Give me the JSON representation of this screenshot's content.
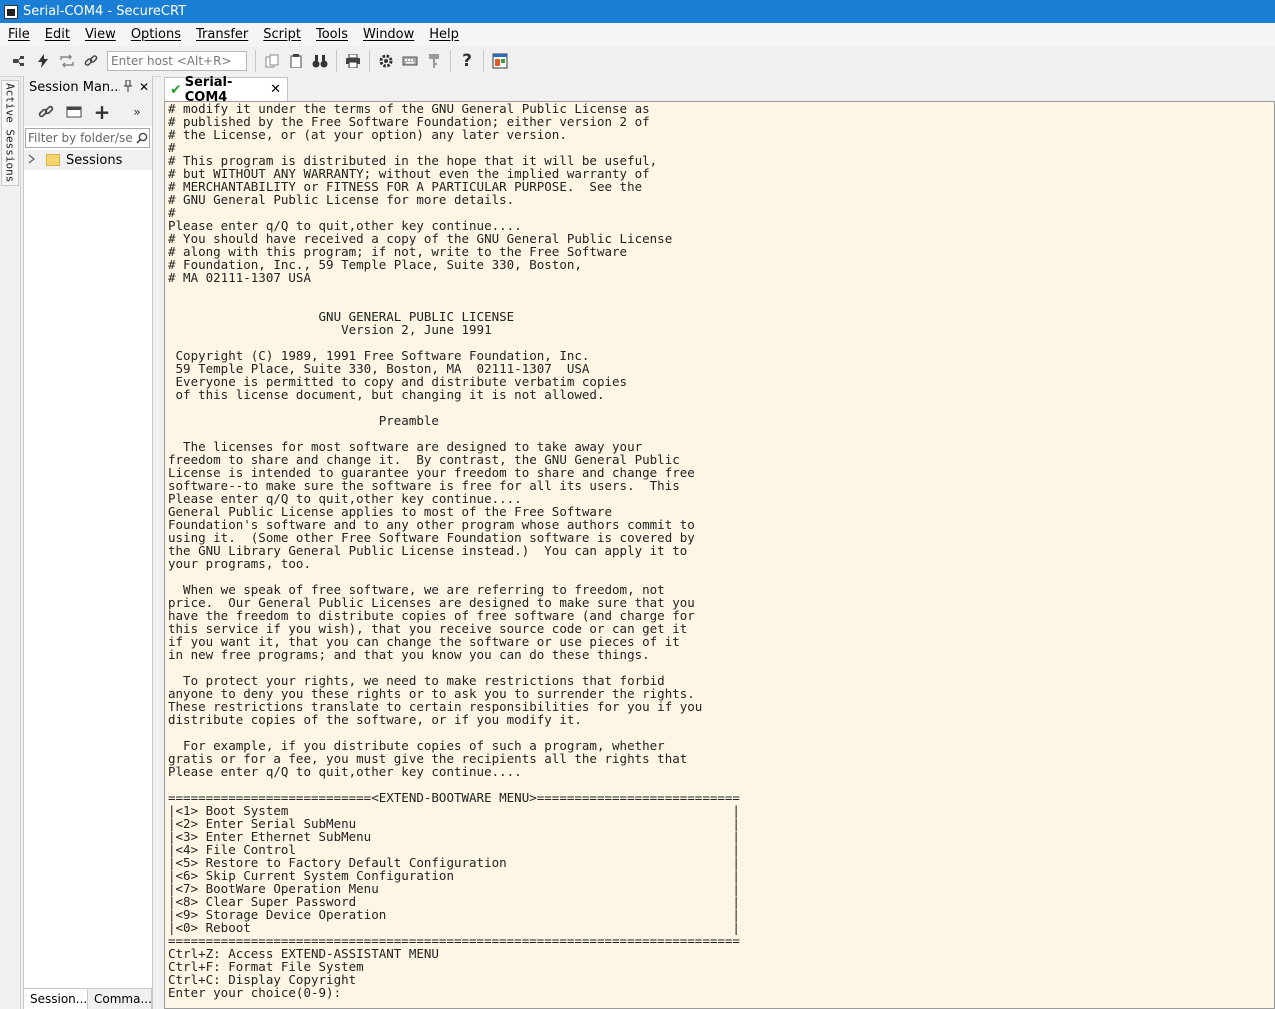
{
  "window": {
    "title": "Serial-COM4 - SecureCRT"
  },
  "menu": [
    "File",
    "Edit",
    "View",
    "Options",
    "Transfer",
    "Script",
    "Tools",
    "Window",
    "Help"
  ],
  "toolbar": {
    "host_placeholder": "Enter host <Alt+R>"
  },
  "vertical_tab": "Active Sessions",
  "session_manager": {
    "title": "Session Man...",
    "filter_placeholder": "Filter by folder/se",
    "tree": [
      {
        "label": "Sessions"
      }
    ],
    "bottom_tabs": [
      "Session...",
      "Comma..."
    ]
  },
  "tabs": [
    {
      "label": "Serial-COM4"
    }
  ],
  "terminal": {
    "lines": [
      "# modify it under the terms of the GNU General Public License as",
      "# published by the Free Software Foundation; either version 2 of",
      "# the License, or (at your option) any later version.",
      "#",
      "# This program is distributed in the hope that it will be useful,",
      "# but WITHOUT ANY WARRANTY; without even the implied warranty of",
      "# MERCHANTABILITY or FITNESS FOR A PARTICULAR PURPOSE.  See the",
      "# GNU General Public License for more details.",
      "#",
      "Please enter q/Q to quit,other key continue....",
      "# You should have received a copy of the GNU General Public License",
      "# along with this program; if not, write to the Free Software",
      "# Foundation, Inc., 59 Temple Place, Suite 330, Boston,",
      "# MA 02111-1307 USA",
      "",
      "",
      "                    GNU GENERAL PUBLIC LICENSE",
      "                       Version 2, June 1991",
      "",
      " Copyright (C) 1989, 1991 Free Software Foundation, Inc.",
      " 59 Temple Place, Suite 330, Boston, MA  02111-1307  USA",
      " Everyone is permitted to copy and distribute verbatim copies",
      " of this license document, but changing it is not allowed.",
      "",
      "                            Preamble",
      "",
      "  The licenses for most software are designed to take away your",
      "freedom to share and change it.  By contrast, the GNU General Public",
      "License is intended to guarantee your freedom to share and change free",
      "software--to make sure the software is free for all its users.  This",
      "Please enter q/Q to quit,other key continue....",
      "General Public License applies to most of the Free Software",
      "Foundation's software and to any other program whose authors commit to",
      "using it.  (Some other Free Software Foundation software is covered by",
      "the GNU Library General Public License instead.)  You can apply it to",
      "your programs, too.",
      "",
      "  When we speak of free software, we are referring to freedom, not",
      "price.  Our General Public Licenses are designed to make sure that you",
      "have the freedom to distribute copies of free software (and charge for",
      "this service if you wish), that you receive source code or can get it",
      "if you want it, that you can change the software or use pieces of it",
      "in new free programs; and that you know you can do these things.",
      "",
      "  To protect your rights, we need to make restrictions that forbid",
      "anyone to deny you these rights or to ask you to surrender the rights.",
      "These restrictions translate to certain responsibilities for you if you",
      "distribute copies of the software, or if you modify it.",
      "",
      "  For example, if you distribute copies of such a program, whether",
      "gratis or for a fee, you must give the recipients all the rights that",
      "Please enter q/Q to quit,other key continue....",
      "",
      "===========================<EXTEND-BOOTWARE MENU>===========================",
      "|<1> Boot System                                                           |",
      "|<2> Enter Serial SubMenu                                                  |",
      "|<3> Enter Ethernet SubMenu                                                |",
      "|<4> File Control                                                          |",
      "|<5> Restore to Factory Default Configuration                              |",
      "|<6> Skip Current System Configuration                                     |",
      "|<7> BootWare Operation Menu                                               |",
      "|<8> Clear Super Password                                                  |",
      "|<9> Storage Device Operation                                              |",
      "|<0> Reboot                                                                |",
      "============================================================================",
      "Ctrl+Z: Access EXTEND-ASSISTANT MENU",
      "Ctrl+F: Format File System",
      "Ctrl+C: Display Copyright",
      "Enter your choice(0-9):"
    ]
  }
}
